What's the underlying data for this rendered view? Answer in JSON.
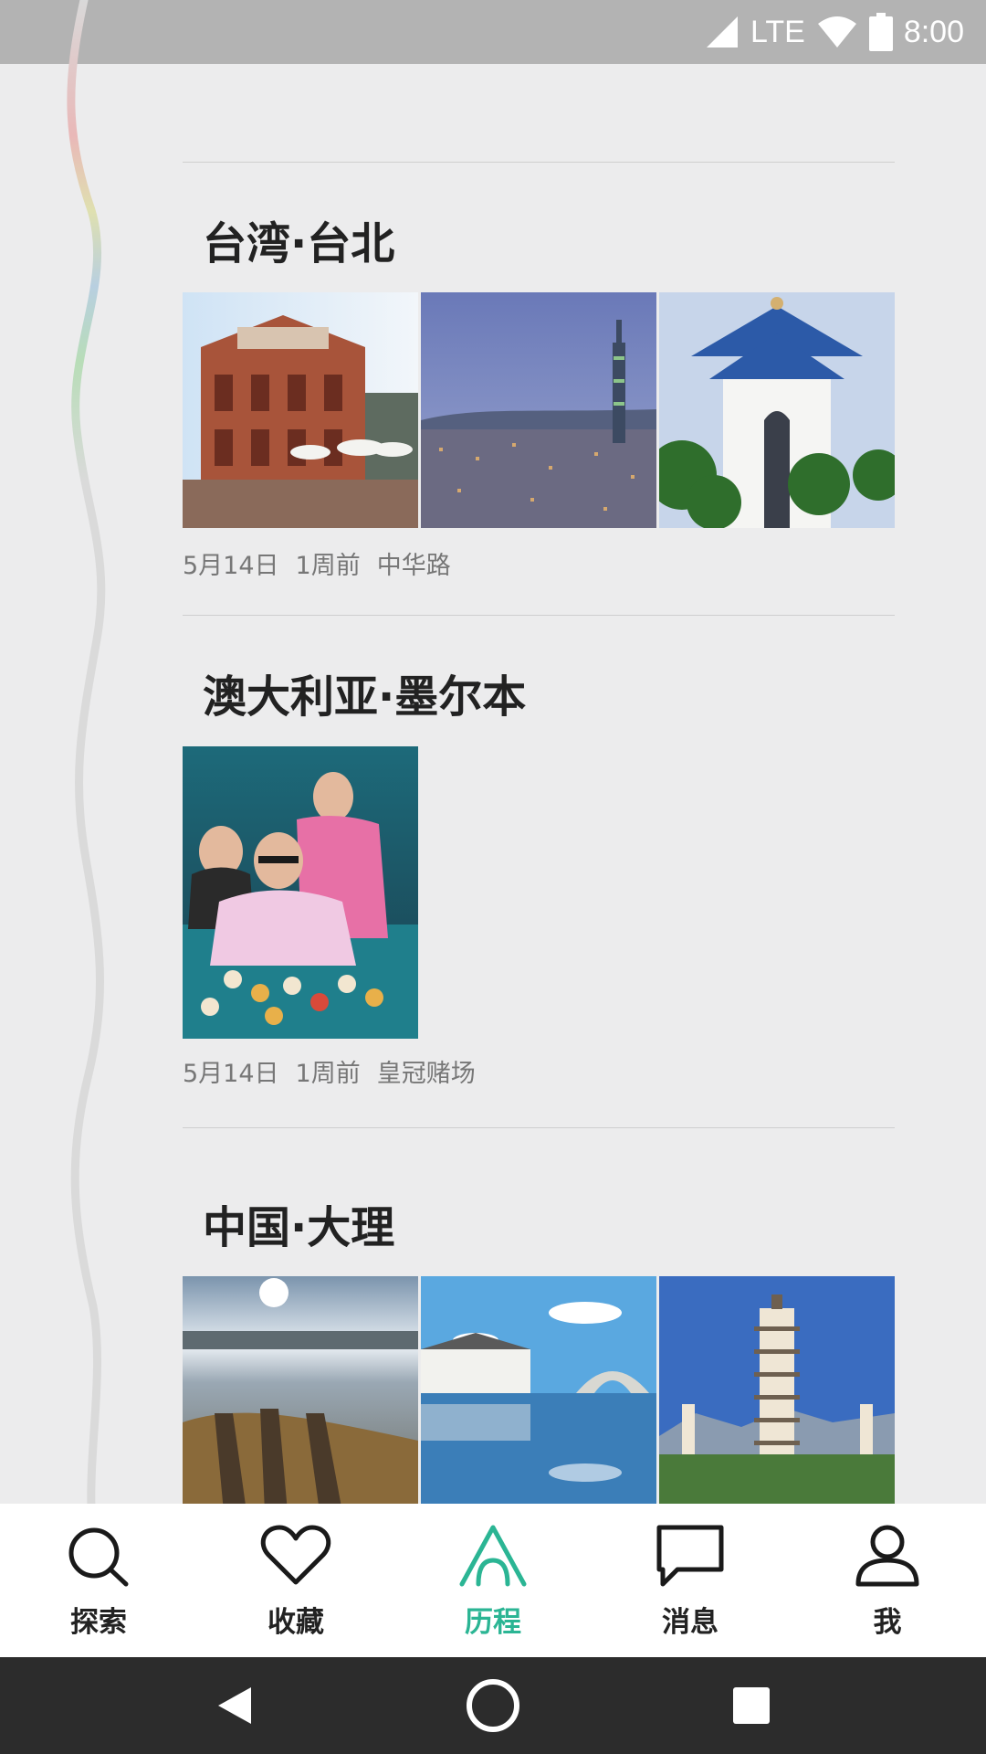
{
  "status_bar": {
    "network": "LTE",
    "time": "8:00"
  },
  "trips": [
    {
      "title": "台湾·台北",
      "date": "5月14日",
      "relative": "1周前",
      "place": "中华路",
      "photos": [
        "red-brick-theater-photo",
        "city-skyline-photo",
        "memorial-hall-photo"
      ]
    },
    {
      "title": "澳大利亚·墨尔本",
      "date": "5月14日",
      "relative": "1周前",
      "place": "皇冠赌场",
      "photos": [
        "casino-table-photo"
      ]
    },
    {
      "title": "中国·大理",
      "photos": [
        "lake-boats-photo",
        "water-town-reflection-photo",
        "pagoda-photo"
      ]
    }
  ],
  "bottom_nav": {
    "items": [
      {
        "label": "探索",
        "icon": "search-icon"
      },
      {
        "label": "收藏",
        "icon": "heart-icon"
      },
      {
        "label": "历程",
        "icon": "journey-icon",
        "active": true
      },
      {
        "label": "消息",
        "icon": "message-icon"
      },
      {
        "label": "我",
        "icon": "profile-icon"
      }
    ]
  },
  "colors": {
    "accent": "#2bb594",
    "status_bar": "#b3b3b3",
    "background": "#ececed",
    "system_nav": "#2c2c2c"
  }
}
